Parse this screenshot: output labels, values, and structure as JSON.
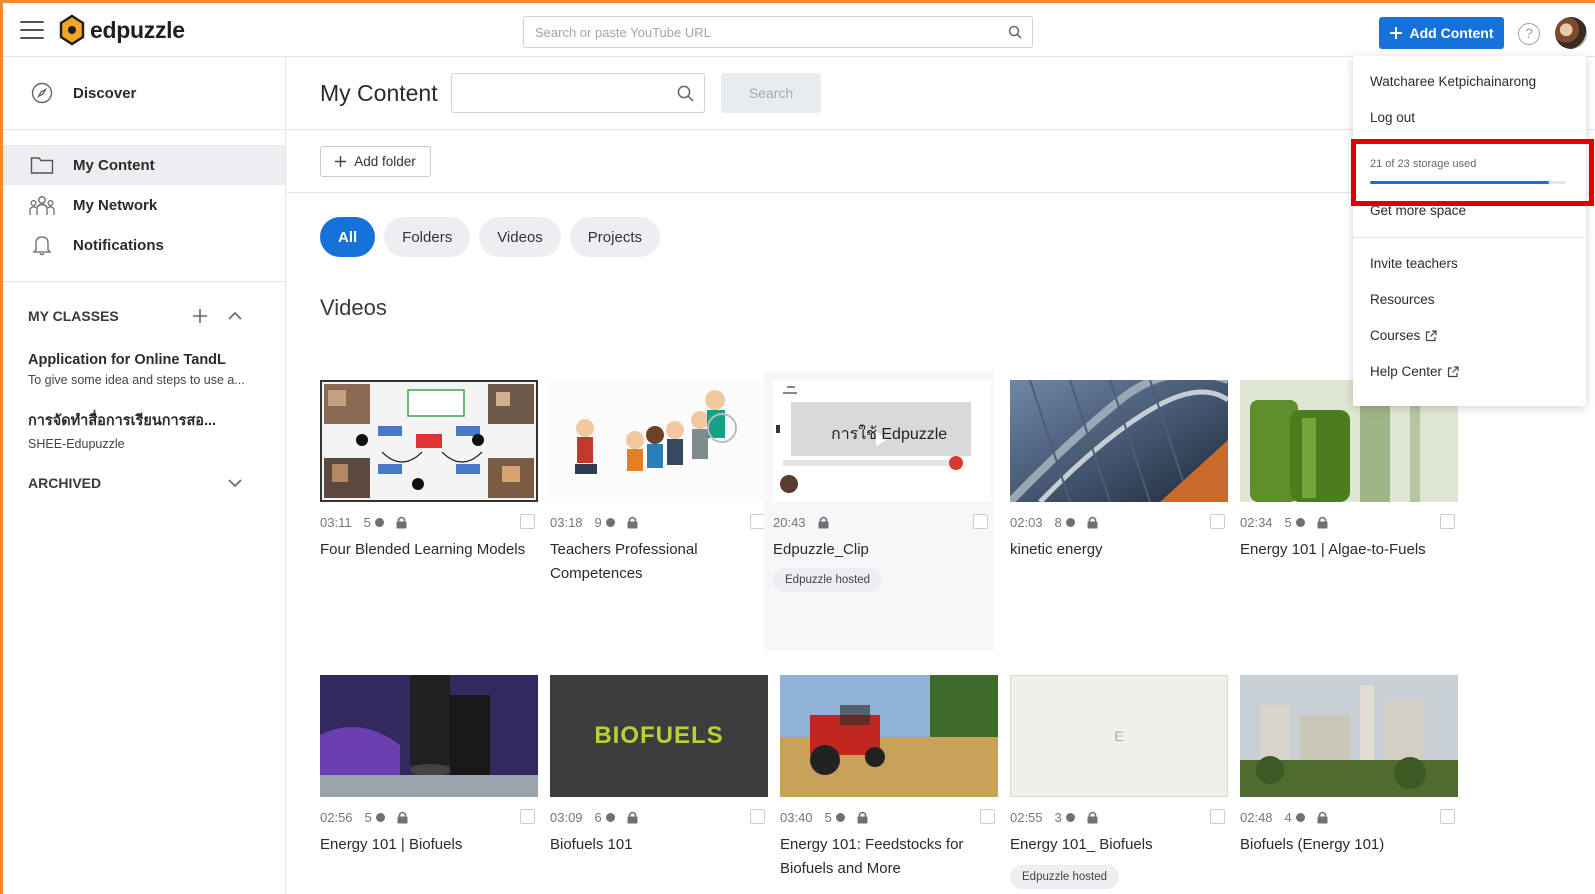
{
  "header": {
    "logo_text": "edpuzzle",
    "search_placeholder": "Search or paste YouTube URL",
    "add_content_label": "Add Content",
    "help_label": "?"
  },
  "sidebar": {
    "nav": [
      {
        "label": "Discover",
        "icon": "compass-icon"
      },
      {
        "label": "My Content",
        "icon": "folder-icon",
        "active": true
      },
      {
        "label": "My Network",
        "icon": "network-icon"
      },
      {
        "label": "Notifications",
        "icon": "bell-icon"
      }
    ],
    "my_classes_title": "MY CLASSES",
    "classes": [
      {
        "name": "Application for Online TandL",
        "subtitle": "To give some idea and steps to use a..."
      },
      {
        "name": "การจัดทำสื่อการเรียนการสอ...",
        "subtitle": "SHEE-Edupuzzle"
      }
    ],
    "archived_title": "ARCHIVED"
  },
  "main": {
    "title": "My Content",
    "search_button": "Search",
    "add_folder_label": "Add folder",
    "filters": [
      "All",
      "Folders",
      "Videos",
      "Projects"
    ],
    "active_filter": "All",
    "section_title": "Videos",
    "videos": [
      {
        "duration": "03:11",
        "questions": "5",
        "title": "Four Blended Learning Models",
        "thumb": "blended-learning-thumb"
      },
      {
        "duration": "03:18",
        "questions": "9",
        "title": "Teachers Professional Competences",
        "thumb": "teachers-cartoon-thumb"
      },
      {
        "duration": "20:43",
        "questions": "",
        "title": "Edpuzzle_Clip",
        "badge": "Edpuzzle hosted",
        "thumb": "edpuzzle-clip-thumb",
        "thumb_text": "การใช้ Edpuzzle"
      },
      {
        "duration": "02:03",
        "questions": "8",
        "title": "kinetic energy",
        "thumb": "rollercoaster-thumb"
      },
      {
        "duration": "02:34",
        "questions": "5",
        "title": "Energy 101 | Algae-to-Fuels",
        "thumb": "algae-thumb"
      },
      {
        "duration": "02:56",
        "questions": "5",
        "title": "Energy 101 | Biofuels",
        "thumb": "microscope-thumb"
      },
      {
        "duration": "03:09",
        "questions": "6",
        "title": "Biofuels 101",
        "thumb": "biofuels-thumb",
        "thumb_text": "BIOFUELS"
      },
      {
        "duration": "03:40",
        "questions": "5",
        "title": "Energy 101: Feedstocks for Biofuels and More",
        "thumb": "tractor-thumb"
      },
      {
        "duration": "02:55",
        "questions": "3",
        "title": "Energy 101_ Biofuels",
        "badge": "Edpuzzle hosted",
        "thumb": "blank-thumb",
        "thumb_text": "E"
      },
      {
        "duration": "02:48",
        "questions": "4",
        "title": "Biofuels (Energy 101)",
        "thumb": "refinery-thumb"
      }
    ]
  },
  "account_menu": {
    "user_name": "Watcharee Ketpichainarong",
    "logout": "Log out",
    "storage_text": "21 of 23 storage used",
    "storage_used": 21,
    "storage_total": 23,
    "get_more_space": "Get more space",
    "invite_teachers": "Invite teachers",
    "resources": "Resources",
    "courses": "Courses",
    "help_center": "Help Center"
  },
  "colors": {
    "accent": "#1672d9",
    "highlight_box": "#e00000",
    "frame": "#f08a35"
  }
}
